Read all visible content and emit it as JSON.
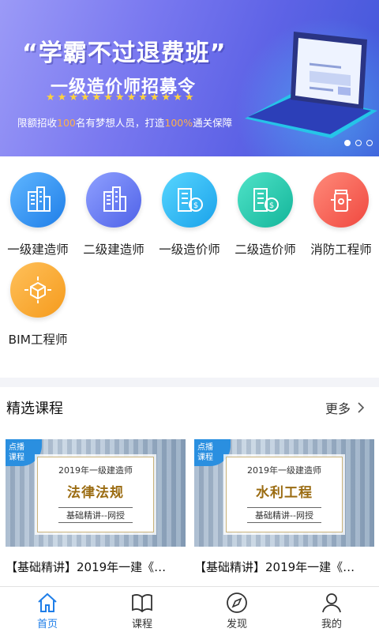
{
  "banner": {
    "title": "“学霸不过退费班”",
    "subtitle": "一级造价师招募令",
    "stars": "★★★★★★★★★★★★★",
    "line_pre": "限额招收",
    "line_num1": "100",
    "line_mid": "名有梦想人员，打造",
    "line_num2": "100%",
    "line_post": "通关保障",
    "page_count": 3,
    "active_page": 1
  },
  "categories": [
    {
      "label": "一级建造师",
      "icon": "building-icon"
    },
    {
      "label": "二级建造师",
      "icon": "building-icon"
    },
    {
      "label": "一级造价师",
      "icon": "building-coin-icon"
    },
    {
      "label": "二级造价师",
      "icon": "building-coin-icon"
    },
    {
      "label": "消防工程师",
      "icon": "hydrant-icon"
    },
    {
      "label": "BIM工程师",
      "icon": "cube-icon"
    }
  ],
  "featured": {
    "heading": "精选课程",
    "more": "更多",
    "courses": [
      {
        "badge_line1": "点播",
        "badge_line2": "课程",
        "year_title": "2019年一级建造师",
        "subject": "法律法规",
        "tag": "基础精讲--网授",
        "title": "【基础精讲】2019年一建《…"
      },
      {
        "badge_line1": "点播",
        "badge_line2": "课程",
        "year_title": "2019年一级建造师",
        "subject": "水利工程",
        "tag": "基础精讲--网授",
        "title": "【基础精讲】2019年一建《…"
      }
    ]
  },
  "tabs": [
    {
      "label": "首页",
      "icon": "home-icon",
      "active": true
    },
    {
      "label": "课程",
      "icon": "book-icon",
      "active": false
    },
    {
      "label": "发现",
      "icon": "compass-icon",
      "active": false
    },
    {
      "label": "我的",
      "icon": "user-icon",
      "active": false
    }
  ],
  "colors": {
    "accent": "#1f7ee8",
    "highlight": "#ffb04a",
    "star": "#ffd23c"
  }
}
